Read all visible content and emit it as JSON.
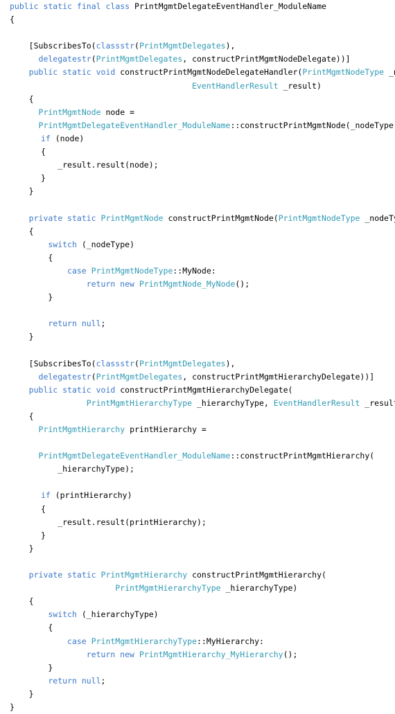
{
  "editor": {
    "title": "PrintMgmtDelegateEventHandler_ModuleName",
    "language": "X++",
    "background_color": "#ffffff",
    "keyword_color": "#3c78c8",
    "type_color": "#2f9ab4",
    "text_color": "#000000",
    "font_size_px": 11.5,
    "line_height_px": 19.1
  },
  "code": {
    "lines": [
      {
        "n": 1,
        "indent": 0,
        "tokens": [
          {
            "t": "public static final class ",
            "c": "kw"
          },
          {
            "t": "PrintMgmtDelegateEventHandler_ModuleName",
            "c": "plain"
          }
        ]
      },
      {
        "n": 2,
        "indent": 0,
        "tokens": [
          {
            "t": "{",
            "c": "plain"
          }
        ]
      },
      {
        "n": 3,
        "indent": 0,
        "tokens": [
          {
            "t": "",
            "c": "plain"
          }
        ]
      },
      {
        "n": 4,
        "indent": 4,
        "tokens": [
          {
            "t": "[SubscribesTo(",
            "c": "plain"
          },
          {
            "t": "classstr",
            "c": "kw"
          },
          {
            "t": "(",
            "c": "plain"
          },
          {
            "t": "PrintMgmtDelegates",
            "c": "type"
          },
          {
            "t": "),",
            "c": "plain"
          }
        ]
      },
      {
        "n": 5,
        "indent": 6,
        "tokens": [
          {
            "t": "delegatestr",
            "c": "kw"
          },
          {
            "t": "(",
            "c": "plain"
          },
          {
            "t": "PrintMgmtDelegates",
            "c": "type"
          },
          {
            "t": ", constructPrintMgmtNodeDelegate))]",
            "c": "plain"
          }
        ]
      },
      {
        "n": 6,
        "indent": 4,
        "tokens": [
          {
            "t": "public static void ",
            "c": "kw"
          },
          {
            "t": "constructPrintMgmtNodeDelegateHandler(",
            "c": "plain"
          },
          {
            "t": "PrintMgmtNodeType",
            "c": "type"
          },
          {
            "t": " _nodeType,",
            "c": "plain"
          }
        ]
      },
      {
        "n": 7,
        "indent": 38,
        "tokens": [
          {
            "t": "EventHandlerResult",
            "c": "type"
          },
          {
            "t": " _result)",
            "c": "plain"
          }
        ]
      },
      {
        "n": 8,
        "indent": 4,
        "tokens": [
          {
            "t": "{",
            "c": "plain"
          }
        ]
      },
      {
        "n": 9,
        "indent": 6,
        "tokens": [
          {
            "t": "PrintMgmtNode",
            "c": "type"
          },
          {
            "t": " node =",
            "c": "plain"
          }
        ]
      },
      {
        "n": 10,
        "indent": 6,
        "tokens": [
          {
            "t": "PrintMgmtDelegateEventHandler_ModuleName",
            "c": "type"
          },
          {
            "t": "::constructPrintMgmtNode(_nodeType);",
            "c": "plain"
          }
        ]
      },
      {
        "n": 11,
        "indent": 6.5,
        "tokens": [
          {
            "t": "if",
            "c": "kw"
          },
          {
            "t": " (node)",
            "c": "plain"
          }
        ]
      },
      {
        "n": 12,
        "indent": 6.5,
        "tokens": [
          {
            "t": "{",
            "c": "plain"
          }
        ]
      },
      {
        "n": 13,
        "indent": 10,
        "tokens": [
          {
            "t": "_result.result(node);",
            "c": "plain"
          }
        ]
      },
      {
        "n": 14,
        "indent": 6.5,
        "tokens": [
          {
            "t": "}",
            "c": "plain"
          }
        ]
      },
      {
        "n": 15,
        "indent": 4,
        "tokens": [
          {
            "t": "}",
            "c": "plain"
          }
        ]
      },
      {
        "n": 16,
        "indent": 0,
        "tokens": [
          {
            "t": "",
            "c": "plain"
          }
        ]
      },
      {
        "n": 17,
        "indent": 4,
        "tokens": [
          {
            "t": "private static ",
            "c": "kw"
          },
          {
            "t": "PrintMgmtNode",
            "c": "type"
          },
          {
            "t": " constructPrintMgmtNode(",
            "c": "plain"
          },
          {
            "t": "PrintMgmtNodeType",
            "c": "type"
          },
          {
            "t": " _nodeType)",
            "c": "plain"
          }
        ]
      },
      {
        "n": 18,
        "indent": 4,
        "tokens": [
          {
            "t": "{",
            "c": "plain"
          }
        ]
      },
      {
        "n": 19,
        "indent": 8,
        "tokens": [
          {
            "t": "switch",
            "c": "kw"
          },
          {
            "t": " (_nodeType)",
            "c": "plain"
          }
        ]
      },
      {
        "n": 20,
        "indent": 8,
        "tokens": [
          {
            "t": "{",
            "c": "plain"
          }
        ]
      },
      {
        "n": 21,
        "indent": 12,
        "tokens": [
          {
            "t": "case",
            "c": "kw"
          },
          {
            "t": " ",
            "c": "plain"
          },
          {
            "t": "PrintMgmtNodeType",
            "c": "type"
          },
          {
            "t": "::MyNode:",
            "c": "plain"
          }
        ]
      },
      {
        "n": 22,
        "indent": 16,
        "tokens": [
          {
            "t": "return new ",
            "c": "kw"
          },
          {
            "t": "PrintMgmtNode_MyNode",
            "c": "type"
          },
          {
            "t": "();",
            "c": "plain"
          }
        ]
      },
      {
        "n": 23,
        "indent": 8,
        "tokens": [
          {
            "t": "}",
            "c": "plain"
          }
        ]
      },
      {
        "n": 24,
        "indent": 0,
        "tokens": [
          {
            "t": "",
            "c": "plain"
          }
        ]
      },
      {
        "n": 25,
        "indent": 8,
        "tokens": [
          {
            "t": "return null",
            "c": "kw"
          },
          {
            "t": ";",
            "c": "plain"
          }
        ]
      },
      {
        "n": 26,
        "indent": 4,
        "tokens": [
          {
            "t": "}",
            "c": "plain"
          }
        ]
      },
      {
        "n": 27,
        "indent": 0,
        "tokens": [
          {
            "t": "",
            "c": "plain"
          }
        ]
      },
      {
        "n": 28,
        "indent": 4,
        "tokens": [
          {
            "t": "[SubscribesTo(",
            "c": "plain"
          },
          {
            "t": "classstr",
            "c": "kw"
          },
          {
            "t": "(",
            "c": "plain"
          },
          {
            "t": "PrintMgmtDelegates",
            "c": "type"
          },
          {
            "t": "),",
            "c": "plain"
          }
        ]
      },
      {
        "n": 29,
        "indent": 6,
        "tokens": [
          {
            "t": "delegatestr",
            "c": "kw"
          },
          {
            "t": "(",
            "c": "plain"
          },
          {
            "t": "PrintMgmtDelegates",
            "c": "type"
          },
          {
            "t": ", constructPrintMgmtHierarchyDelegate))]",
            "c": "plain"
          }
        ]
      },
      {
        "n": 30,
        "indent": 4,
        "tokens": [
          {
            "t": "public static void ",
            "c": "kw"
          },
          {
            "t": "constructPrintMgmtHierarchyDelegate(",
            "c": "plain"
          }
        ]
      },
      {
        "n": 31,
        "indent": 16,
        "tokens": [
          {
            "t": "PrintMgmtHierarchyType",
            "c": "type"
          },
          {
            "t": " _hierarchyType, ",
            "c": "plain"
          },
          {
            "t": "EventHandlerResult",
            "c": "type"
          },
          {
            "t": " _result)",
            "c": "plain"
          }
        ]
      },
      {
        "n": 32,
        "indent": 4,
        "tokens": [
          {
            "t": "{",
            "c": "plain"
          }
        ]
      },
      {
        "n": 33,
        "indent": 6,
        "tokens": [
          {
            "t": "PrintMgmtHierarchy",
            "c": "type"
          },
          {
            "t": " printHierarchy =",
            "c": "plain"
          }
        ]
      },
      {
        "n": 34,
        "indent": 0,
        "tokens": [
          {
            "t": "",
            "c": "plain"
          }
        ]
      },
      {
        "n": 35,
        "indent": 6,
        "tokens": [
          {
            "t": "PrintMgmtDelegateEventHandler_ModuleName",
            "c": "type"
          },
          {
            "t": "::constructPrintMgmtHierarchy(",
            "c": "plain"
          }
        ]
      },
      {
        "n": 36,
        "indent": 10,
        "tokens": [
          {
            "t": "_hierarchyType);",
            "c": "plain"
          }
        ]
      },
      {
        "n": 37,
        "indent": 0,
        "tokens": [
          {
            "t": "",
            "c": "plain"
          }
        ]
      },
      {
        "n": 38,
        "indent": 6.5,
        "tokens": [
          {
            "t": "if",
            "c": "kw"
          },
          {
            "t": " (printHierarchy)",
            "c": "plain"
          }
        ]
      },
      {
        "n": 39,
        "indent": 6.5,
        "tokens": [
          {
            "t": "{",
            "c": "plain"
          }
        ]
      },
      {
        "n": 40,
        "indent": 10,
        "tokens": [
          {
            "t": "_result.result(printHierarchy);",
            "c": "plain"
          }
        ]
      },
      {
        "n": 41,
        "indent": 6.5,
        "tokens": [
          {
            "t": "}",
            "c": "plain"
          }
        ]
      },
      {
        "n": 42,
        "indent": 4,
        "tokens": [
          {
            "t": "}",
            "c": "plain"
          }
        ]
      },
      {
        "n": 43,
        "indent": 0,
        "tokens": [
          {
            "t": "",
            "c": "plain"
          }
        ]
      },
      {
        "n": 44,
        "indent": 4,
        "tokens": [
          {
            "t": "private static ",
            "c": "kw"
          },
          {
            "t": "PrintMgmtHierarchy",
            "c": "type"
          },
          {
            "t": " constructPrintMgmtHierarchy(",
            "c": "plain"
          }
        ]
      },
      {
        "n": 45,
        "indent": 22,
        "tokens": [
          {
            "t": "PrintMgmtHierarchyType",
            "c": "type"
          },
          {
            "t": " _hierarchyType)",
            "c": "plain"
          }
        ]
      },
      {
        "n": 46,
        "indent": 4,
        "tokens": [
          {
            "t": "{",
            "c": "plain"
          }
        ]
      },
      {
        "n": 47,
        "indent": 8,
        "tokens": [
          {
            "t": "switch",
            "c": "kw"
          },
          {
            "t": " (_hierarchyType)",
            "c": "plain"
          }
        ]
      },
      {
        "n": 48,
        "indent": 8,
        "tokens": [
          {
            "t": "{",
            "c": "plain"
          }
        ]
      },
      {
        "n": 49,
        "indent": 12,
        "tokens": [
          {
            "t": "case",
            "c": "kw"
          },
          {
            "t": " ",
            "c": "plain"
          },
          {
            "t": "PrintMgmtHierarchyType",
            "c": "type"
          },
          {
            "t": "::MyHierarchy:",
            "c": "plain"
          }
        ]
      },
      {
        "n": 50,
        "indent": 16,
        "tokens": [
          {
            "t": "return new ",
            "c": "kw"
          },
          {
            "t": "PrintMgmtHierarchy_MyHierarchy",
            "c": "type"
          },
          {
            "t": "();",
            "c": "plain"
          }
        ]
      },
      {
        "n": 51,
        "indent": 8,
        "tokens": [
          {
            "t": "}",
            "c": "plain"
          }
        ]
      },
      {
        "n": 52,
        "indent": 8,
        "tokens": [
          {
            "t": "return null",
            "c": "kw"
          },
          {
            "t": ";",
            "c": "plain"
          }
        ]
      },
      {
        "n": 53,
        "indent": 4,
        "tokens": [
          {
            "t": "}",
            "c": "plain"
          }
        ]
      },
      {
        "n": 54,
        "indent": 0,
        "tokens": [
          {
            "t": "}",
            "c": "plain"
          }
        ]
      }
    ]
  }
}
